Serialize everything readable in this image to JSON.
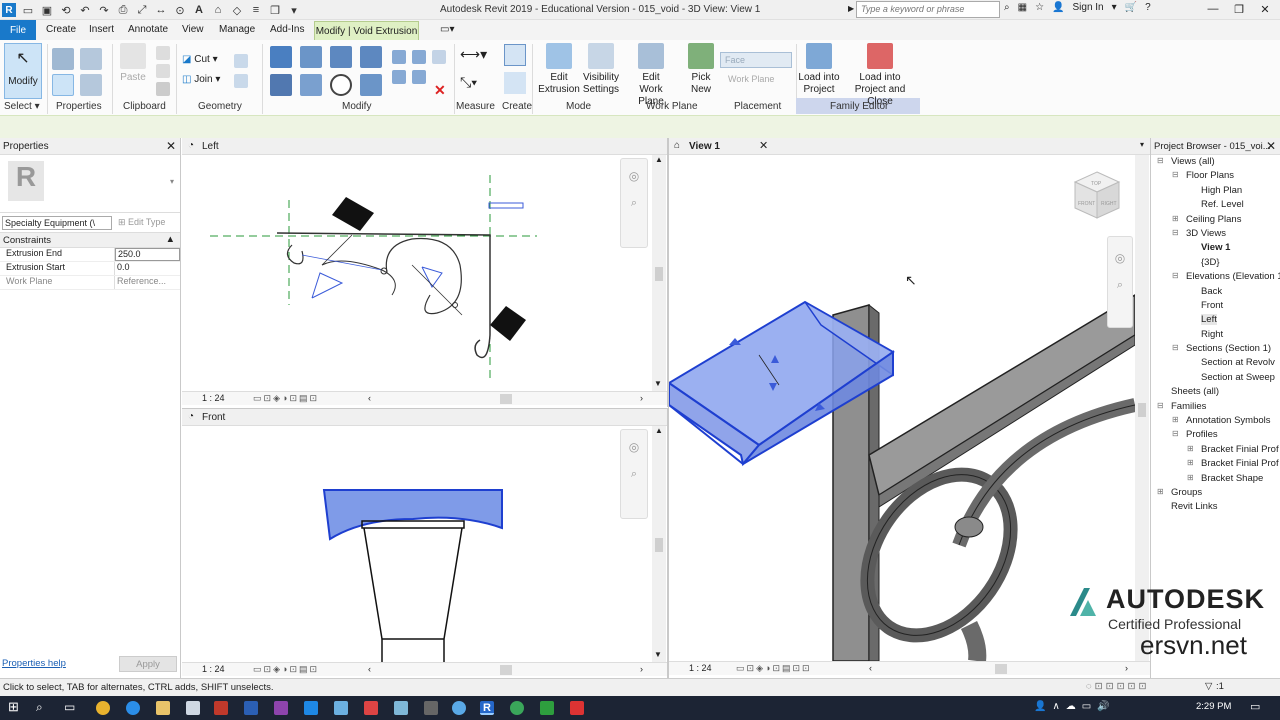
{
  "app": {
    "title": "Autodesk Revit 2019 - Educational Version - 015_void - 3D View: View 1",
    "search_placeholder": "Type a keyword or phrase",
    "sign_in": "Sign In"
  },
  "tabs": {
    "file": "File",
    "create": "Create",
    "insert": "Insert",
    "annotate": "Annotate",
    "view": "View",
    "manage": "Manage",
    "addins": "Add-Ins",
    "context": "Modify | Void Extrusion"
  },
  "ribbon": {
    "modify": "Modify",
    "select": "Select ▾",
    "properties": "Properties",
    "clipboard": "Clipboard",
    "paste": "Paste",
    "cut": "Cut",
    "join": "Join",
    "geometry": "Geometry",
    "modify_group": "Modify",
    "measure": "Measure",
    "create": "Create",
    "edit_extrusion_1": "Edit",
    "edit_extrusion_2": "Extrusion",
    "visibility_1": "Visibility",
    "visibility_2": "Settings",
    "edit_wp_1": "Edit",
    "edit_wp_2": "Work Plane",
    "mode": "Mode",
    "pick_new_1": "Pick",
    "pick_new_2": "New",
    "work_plane": "Work Plane",
    "face": "Face",
    "work_plane_btn": "Work Plane",
    "placement": "Placement",
    "load_proj_1": "Load into",
    "load_proj_2": "Project",
    "load_close_1": "Load into",
    "load_close_2": "Project and Close",
    "family_editor": "Family Editor"
  },
  "properties": {
    "title": "Properties",
    "type_selector": "Specialty Equipment (\\",
    "edit_type": "Edit Type",
    "section": "Constraints",
    "rows": [
      {
        "k": "Extrusion End",
        "v": "250.0"
      },
      {
        "k": "Extrusion Start",
        "v": "0.0"
      },
      {
        "k": "Work Plane",
        "v": "Reference..."
      }
    ],
    "help": "Properties help",
    "apply": "Apply"
  },
  "views": {
    "left_title": "Left",
    "front_title": "Front",
    "view1_title": "View 1",
    "scale": "1 : 24"
  },
  "browser": {
    "title": "Project Browser - 015_voi...",
    "items": [
      "Views (all)",
      "Floor Plans",
      "High Plan",
      "Ref. Level",
      "Ceiling Plans",
      "3D Views",
      "View 1",
      "{3D}",
      "Elevations (Elevation 1",
      "Back",
      "Front",
      "Left",
      "Right",
      "Sections (Section 1)",
      "Section at Revolv",
      "Section at Sweep",
      "Sheets (all)",
      "Families",
      "Annotation Symbols",
      "Profiles",
      "Bracket Finial Prof",
      "Bracket Finial Prof",
      "Bracket Shape",
      "Groups",
      "Revit Links"
    ]
  },
  "status": {
    "text": "Click to select, TAB for alternates, CTRL adds, SHIFT unselects.",
    "filter_count": ":1"
  },
  "watermark": {
    "brand": "AUTODESK",
    "certified": "Certified Professional",
    "site": "ersvn.net"
  },
  "viewcube": {
    "top": "TOP",
    "front": "FRONT",
    "right": "RIGHT"
  },
  "taskbar": {
    "time": "2:29 PM"
  },
  "colors": {
    "file_tab": "#1979ca",
    "context_tab": "#dff0c4",
    "selection": "#3b5bd9",
    "option_bar": "#eef4e3"
  }
}
